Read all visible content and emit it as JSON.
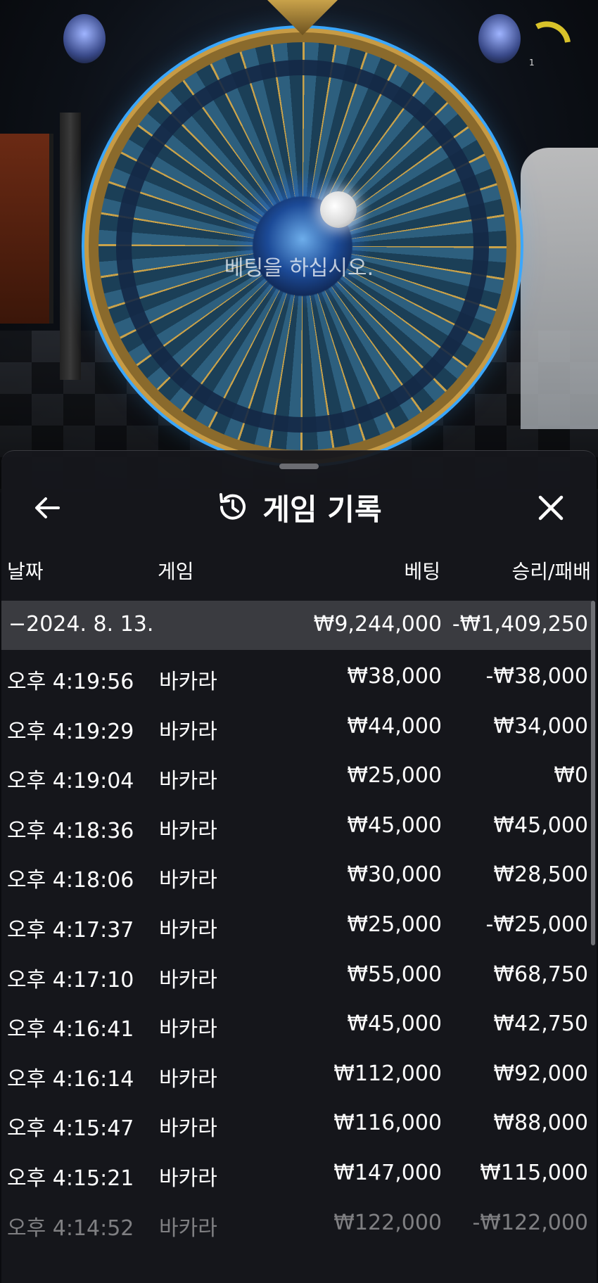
{
  "game_scene": {
    "prompt": "베팅을 하십시오.",
    "timer_value": "1"
  },
  "panel": {
    "title": "게임 기록",
    "icons": {
      "back": "arrow-left-icon",
      "history": "history-clock-icon",
      "close": "close-icon"
    },
    "columns": {
      "date": "날짜",
      "game": "게임",
      "bet": "베팅",
      "win_loss": "승리/패배"
    },
    "day_summary": {
      "date": "−2024. 8. 13.",
      "bet": "₩9,244,000",
      "win_loss": "-₩1,409,250"
    },
    "rows": [
      {
        "time": "오후 4:19:56",
        "game": "바카라",
        "bet": "₩38,000",
        "win_loss": "-₩38,000"
      },
      {
        "time": "오후 4:19:29",
        "game": "바카라",
        "bet": "₩44,000",
        "win_loss": "₩34,000"
      },
      {
        "time": "오후 4:19:04",
        "game": "바카라",
        "bet": "₩25,000",
        "win_loss": "₩0"
      },
      {
        "time": "오후 4:18:36",
        "game": "바카라",
        "bet": "₩45,000",
        "win_loss": "₩45,000"
      },
      {
        "time": "오후 4:18:06",
        "game": "바카라",
        "bet": "₩30,000",
        "win_loss": "₩28,500"
      },
      {
        "time": "오후 4:17:37",
        "game": "바카라",
        "bet": "₩25,000",
        "win_loss": "-₩25,000"
      },
      {
        "time": "오후 4:17:10",
        "game": "바카라",
        "bet": "₩55,000",
        "win_loss": "₩68,750"
      },
      {
        "time": "오후 4:16:41",
        "game": "바카라",
        "bet": "₩45,000",
        "win_loss": "₩42,750"
      },
      {
        "time": "오후 4:16:14",
        "game": "바카라",
        "bet": "₩112,000",
        "win_loss": "₩92,000"
      },
      {
        "time": "오후 4:15:47",
        "game": "바카라",
        "bet": "₩116,000",
        "win_loss": "₩88,000"
      },
      {
        "time": "오후 4:15:21",
        "game": "바카라",
        "bet": "₩147,000",
        "win_loss": "₩115,000"
      },
      {
        "time": "오후 4:14:52",
        "game": "바카라",
        "bet": "₩122,000",
        "win_loss": "-₩122,000"
      }
    ]
  }
}
